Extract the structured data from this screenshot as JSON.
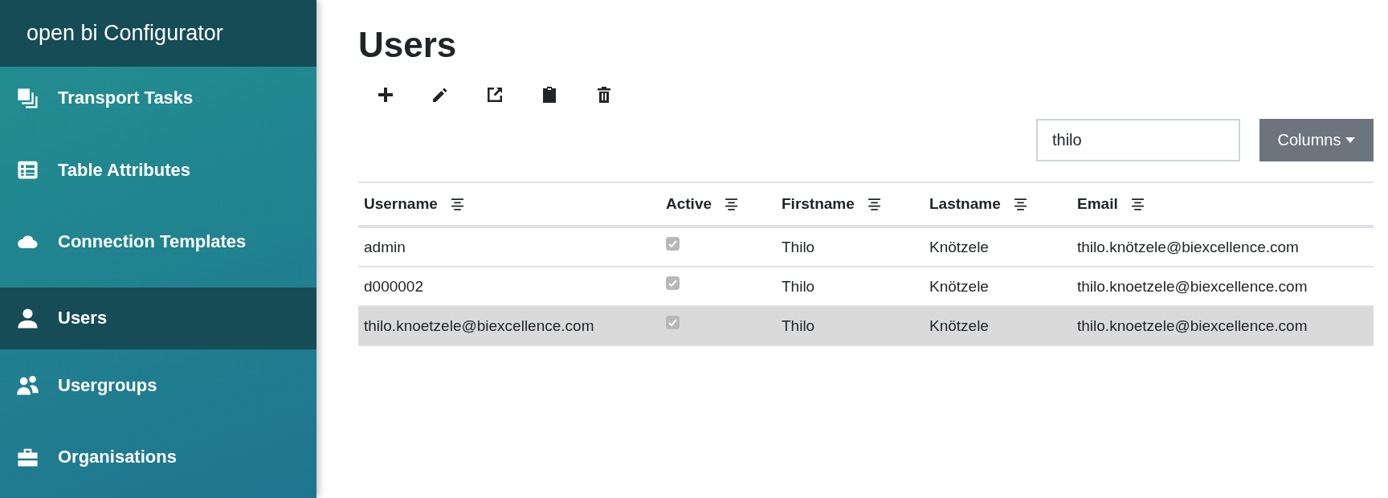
{
  "sidebar": {
    "title": "open bi Configurator",
    "items": [
      {
        "label": "Transport Tasks",
        "selected": false
      },
      {
        "label": "Table Attributes",
        "selected": false
      },
      {
        "label": "Connection Templates",
        "selected": false
      },
      {
        "label": "Users",
        "selected": true
      },
      {
        "label": "Usergroups",
        "selected": false
      },
      {
        "label": "Organisations",
        "selected": false
      }
    ]
  },
  "page": {
    "title": "Users"
  },
  "search": {
    "value": "thilo"
  },
  "columns_button": {
    "label": "Columns"
  },
  "table": {
    "columns": [
      "Username",
      "Active",
      "Firstname",
      "Lastname",
      "Email"
    ],
    "rows": [
      {
        "username": "admin",
        "active": true,
        "firstname": "Thilo",
        "lastname": "Knötzele",
        "email": "thilo.knötzele@biexcellence.com",
        "selected": false
      },
      {
        "username": "d000002",
        "active": true,
        "firstname": "Thilo",
        "lastname": "Knötzele",
        "email": "thilo.knoetzele@biexcellence.com",
        "selected": false
      },
      {
        "username": "thilo.knoetzele@biexcellence.com",
        "active": true,
        "firstname": "Thilo",
        "lastname": "Knötzele",
        "email": "thilo.knoetzele@biexcellence.com",
        "selected": true
      }
    ]
  }
}
